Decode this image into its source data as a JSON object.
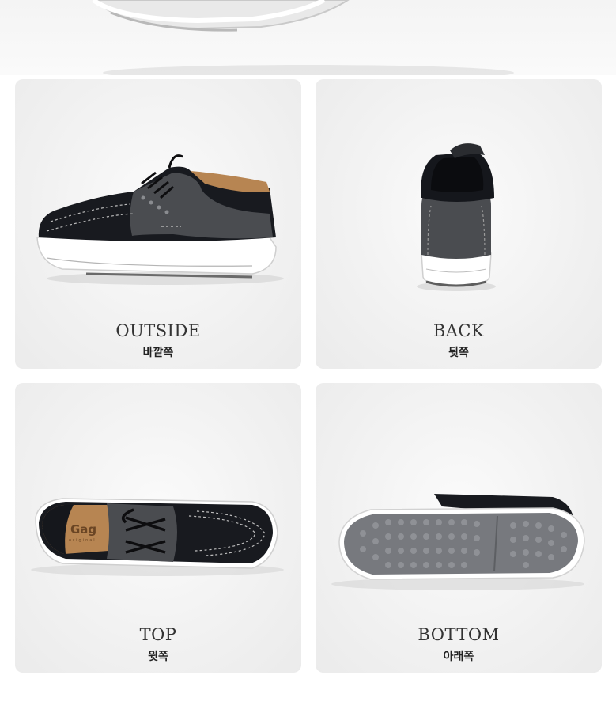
{
  "views": [
    {
      "en": "OUTSIDE",
      "ko": "바깥쪽",
      "icon": "shoe-side-icon"
    },
    {
      "en": "BACK",
      "ko": "뒷쪽",
      "icon": "shoe-back-icon"
    },
    {
      "en": "TOP",
      "ko": "윗쪽",
      "icon": "shoe-top-icon"
    },
    {
      "en": "BOTTOM",
      "ko": "아래쪽",
      "icon": "shoe-sole-icon"
    }
  ],
  "insole_brand": {
    "name": "Gag",
    "sub": "original"
  },
  "colors": {
    "upper": "#15171c",
    "leather": "#4a4c50",
    "sole": "#ffffff",
    "sole_tread": "#77797e",
    "lining": "#b78552"
  }
}
